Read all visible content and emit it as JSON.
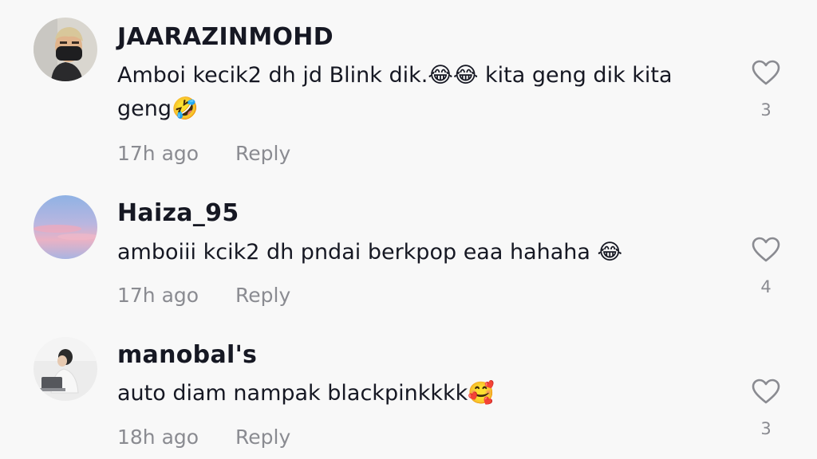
{
  "comments": [
    {
      "username": "JAARAZINMOHD",
      "text": "Amboi kecik2 dh jd Blink dik.😂😂 kita geng dik kita geng🤣",
      "time": "17h ago",
      "reply_label": "Reply",
      "like_count": "3",
      "avatar_icon": "avatar-masked-man"
    },
    {
      "username": "Haiza_95",
      "text": "amboiii kcik2 dh pndai berkpop eaa hahaha 😂",
      "time": "17h ago",
      "reply_label": "Reply",
      "like_count": "4",
      "avatar_icon": "avatar-sunset-sky"
    },
    {
      "username": "manobal's",
      "text": "auto diam nampak blackpinkkkk🥰",
      "time": "18h ago",
      "reply_label": "Reply",
      "like_count": "3",
      "avatar_icon": "avatar-person-laptop"
    }
  ],
  "colors": {
    "background": "#f8f8f8",
    "text": "#161823",
    "secondary": "#8a8b91"
  }
}
